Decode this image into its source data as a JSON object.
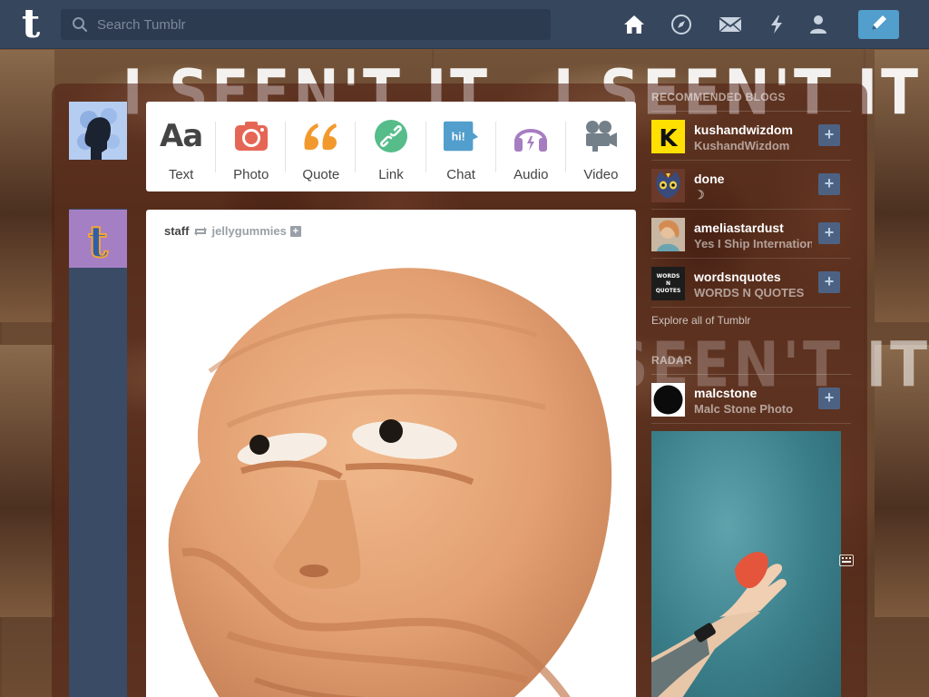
{
  "header": {
    "logo_letter": "t",
    "search_placeholder": "Search Tumblr",
    "nav": {
      "home_icon": "home-icon",
      "explore_icon": "compass-icon",
      "inbox_icon": "envelope-icon",
      "activity_icon": "lightning-icon",
      "account_icon": "person-icon",
      "compose_icon": "pencil-icon"
    },
    "colors": {
      "bar": "#36465d",
      "compose": "#529ecc"
    }
  },
  "background": {
    "banner_text": "I SEEN'T IT"
  },
  "post_types": [
    {
      "label": "Text",
      "glyph": "Aa"
    },
    {
      "label": "Photo"
    },
    {
      "label": "Quote",
      "glyph": "❝"
    },
    {
      "label": "Link"
    },
    {
      "label": "Chat",
      "glyph": "hi!"
    },
    {
      "label": "Audio"
    },
    {
      "label": "Video"
    }
  ],
  "post": {
    "author": "staff",
    "reblogged_from": "jellygummies",
    "follow_plus": "+",
    "image_subject": "clay-face-image"
  },
  "sidebar": {
    "recommended_heading": "RECOMMENDED BLOGS",
    "blogs": [
      {
        "name": "kushandwizdom",
        "title": "KushandWizdom",
        "avatar_letter": "K"
      },
      {
        "name": "done",
        "title": "☽"
      },
      {
        "name": "ameliastardust",
        "title": "Yes I Ship International"
      },
      {
        "name": "wordsnquotes",
        "title": "WORDS N QUOTES",
        "avatar_text": "WORDS N QUOTES"
      }
    ],
    "follow_label": "+",
    "explore_link": "Explore all of Tumblr",
    "radar_heading": "RADAR",
    "radar_blog": {
      "name": "malcstone",
      "title": "Malc Stone Photo"
    }
  }
}
